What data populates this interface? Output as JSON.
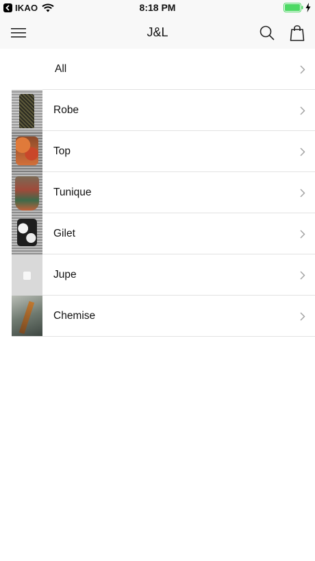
{
  "status_bar": {
    "back_app": "IKAO",
    "time": "8:18 PM"
  },
  "nav": {
    "title": "J&L",
    "menu_icon": "hamburger-menu-icon",
    "search_icon": "search-icon",
    "bag_icon": "shopping-bag-icon"
  },
  "categories": [
    {
      "label": "All",
      "thumbnail": "none"
    },
    {
      "label": "Robe",
      "thumbnail": "dark patterned dress photo"
    },
    {
      "label": "Top",
      "thumbnail": "orange floral top photo"
    },
    {
      "label": "Tunique",
      "thumbnail": "multicolor tunic photo"
    },
    {
      "label": "Gilet",
      "thumbnail": "black and white gilet photo"
    },
    {
      "label": "Jupe",
      "thumbnail": "placeholder image"
    },
    {
      "label": "Chemise",
      "thumbnail": "shirt photo"
    }
  ],
  "colors": {
    "bar_background": "#f8f8f8",
    "divider": "#e2e2e2",
    "chevron": "#9e9e9e",
    "battery": "#4cd964"
  }
}
